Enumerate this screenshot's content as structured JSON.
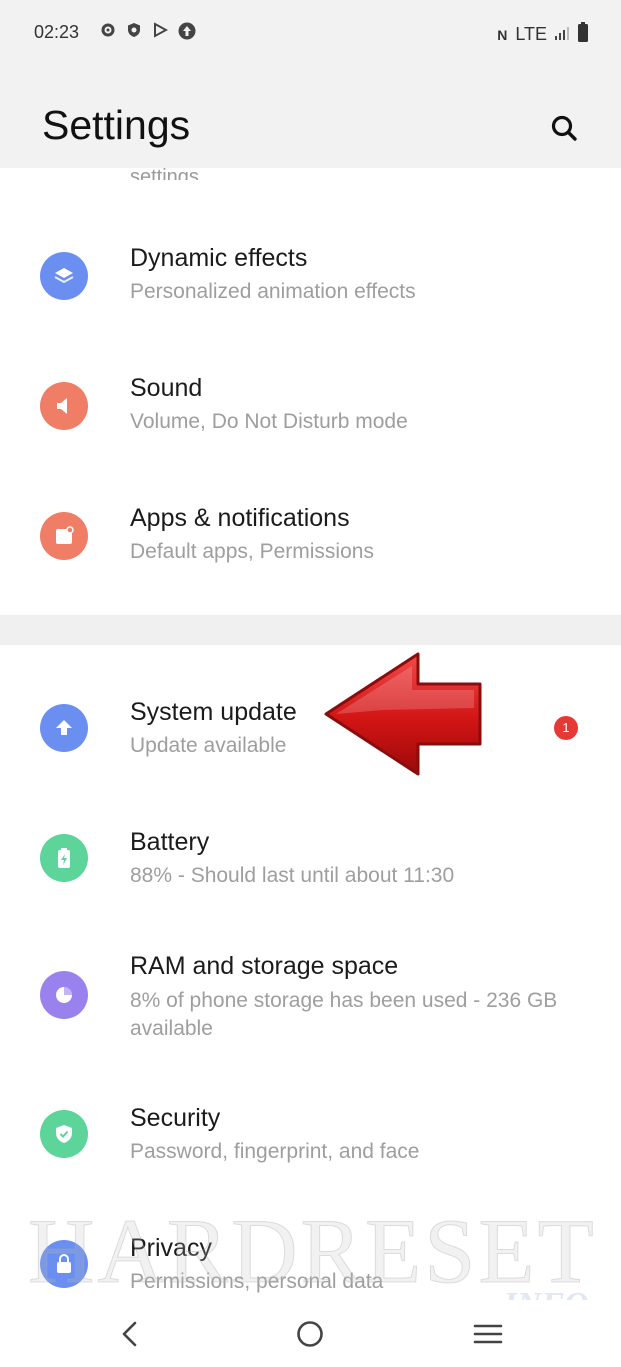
{
  "status_bar": {
    "time": "02:23",
    "left_icons": [
      "gear-icon",
      "shield-icon",
      "play-store-icon",
      "upload-icon"
    ],
    "nfc": "N",
    "network": "LTE",
    "icons_right": [
      "signal-icon",
      "battery-icon"
    ]
  },
  "header": {
    "title": "Settings",
    "search_icon": "search-icon"
  },
  "clipped_item_text": "settings",
  "settings_items": [
    {
      "id": "dynamic-effects",
      "title": "Dynamic effects",
      "subtitle": "Personalized animation effects",
      "icon": "layers-icon",
      "color": "#6a8ff0"
    },
    {
      "id": "sound",
      "title": "Sound",
      "subtitle": "Volume, Do Not Disturb mode",
      "icon": "speaker-icon",
      "color": "#f07d66"
    },
    {
      "id": "apps-notifications",
      "title": "Apps & notifications",
      "subtitle": "Default apps, Permissions",
      "icon": "apps-icon",
      "color": "#f07d66"
    },
    {
      "id": "system-update",
      "title": "System update",
      "subtitle": "Update available",
      "icon": "arrow-up-icon",
      "color": "#6a8ff0",
      "badge": "1"
    },
    {
      "id": "battery",
      "title": "Battery",
      "subtitle": "88% - Should last until about 11:30",
      "icon": "battery-icon",
      "color": "#5cd49a"
    },
    {
      "id": "ram-storage",
      "title": "RAM and storage space",
      "subtitle": "8% of phone storage has been used - 236 GB available",
      "icon": "pie-icon",
      "color": "#9a82ee"
    },
    {
      "id": "security",
      "title": "Security",
      "subtitle": "Password, fingerprint, and face",
      "icon": "shield-check-icon",
      "color": "#5cd49a"
    },
    {
      "id": "privacy",
      "title": "Privacy",
      "subtitle": "Permissions, personal data",
      "icon": "lock-icon",
      "color": "#6a8ff0"
    }
  ],
  "annotation": {
    "arrow_color": "#d81818"
  },
  "watermark": {
    "main": "HARDRESET",
    "sub": ".INFO"
  },
  "nav_bar": {
    "back_icon": "back-icon",
    "home_icon": "home-icon",
    "menu_icon": "menu-icon"
  }
}
